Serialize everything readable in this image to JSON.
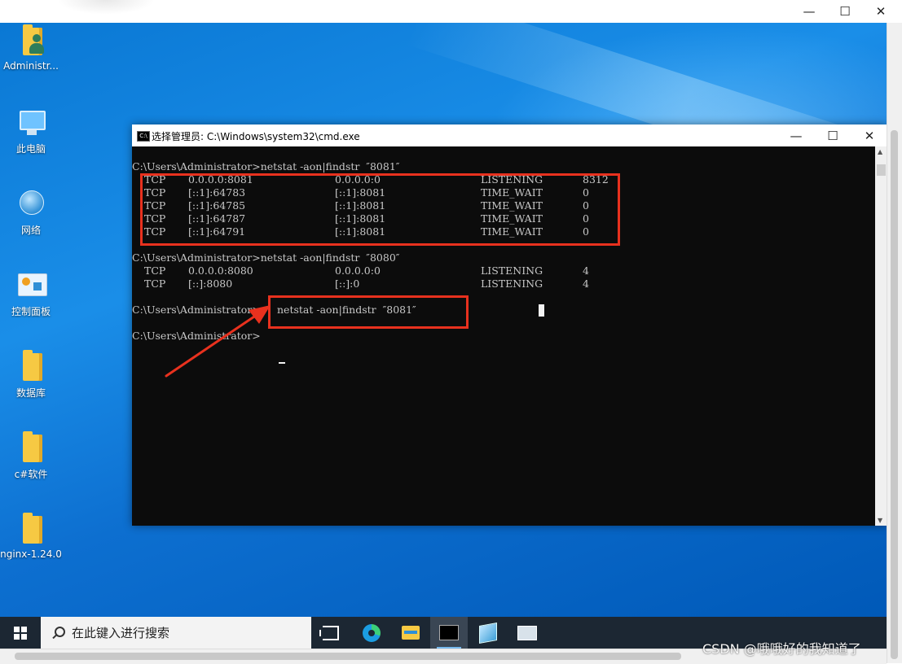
{
  "outer_window": {
    "minimize": "—",
    "maximize": "☐",
    "close": "✕"
  },
  "desktop_icons": [
    {
      "label": "Administr...",
      "icon": "user-folder-icon"
    },
    {
      "label": "此电脑",
      "icon": "this-pc-icon"
    },
    {
      "label": "网络",
      "icon": "network-icon"
    },
    {
      "label": "控制面板",
      "icon": "control-panel-icon"
    },
    {
      "label": "数据库",
      "icon": "folder-icon"
    },
    {
      "label": "c#软件",
      "icon": "folder-icon"
    },
    {
      "label": "nginx-1.24.0",
      "icon": "folder-icon"
    }
  ],
  "cmd_window": {
    "title": "选择管理员: C:\\Windows\\system32\\cmd.exe",
    "icon_text": "C:\\",
    "minimize": "—",
    "maximize": "☐",
    "close": "✕",
    "prompt_1": "C:\\Users\\Administrator>netstat -aon|findstr  ″8081″",
    "result_1": [
      {
        "proto": "TCP",
        "local": "0.0.0.0:8081",
        "foreign": "0.0.0.0:0",
        "state": "LISTENING",
        "pid": "8312"
      },
      {
        "proto": "TCP",
        "local": "[::1]:64783",
        "foreign": "[::1]:8081",
        "state": "TIME_WAIT",
        "pid": "0"
      },
      {
        "proto": "TCP",
        "local": "[::1]:64785",
        "foreign": "[::1]:8081",
        "state": "TIME_WAIT",
        "pid": "0"
      },
      {
        "proto": "TCP",
        "local": "[::1]:64787",
        "foreign": "[::1]:8081",
        "state": "TIME_WAIT",
        "pid": "0"
      },
      {
        "proto": "TCP",
        "local": "[::1]:64791",
        "foreign": "[::1]:8081",
        "state": "TIME_WAIT",
        "pid": "0"
      }
    ],
    "prompt_2": "C:\\Users\\Administrator>netstat -aon|findstr  ″8080″",
    "result_2": [
      {
        "proto": "TCP",
        "local": "0.0.0.0:8080",
        "foreign": "0.0.0.0:0",
        "state": "LISTENING",
        "pid": "4"
      },
      {
        "proto": "TCP",
        "local": "[::]:8080",
        "foreign": "[::]:0",
        "state": "LISTENING",
        "pid": "4"
      }
    ],
    "prompt_3_path": "C:\\Users\\Administrator>",
    "prompt_3_cmd": "netstat -aon|findstr  ″8081″",
    "prompt_4": "C:\\Users\\Administrator>",
    "annotation_color": "#e8311e"
  },
  "taskbar": {
    "search_placeholder": "在此键入进行搜索",
    "apps": [
      "task-view-icon",
      "edge-icon",
      "file-explorer-icon",
      "cmd-icon",
      "package-icon",
      "remote-pc-icon"
    ]
  },
  "watermark": "CSDN @哦哦好的我知道了"
}
